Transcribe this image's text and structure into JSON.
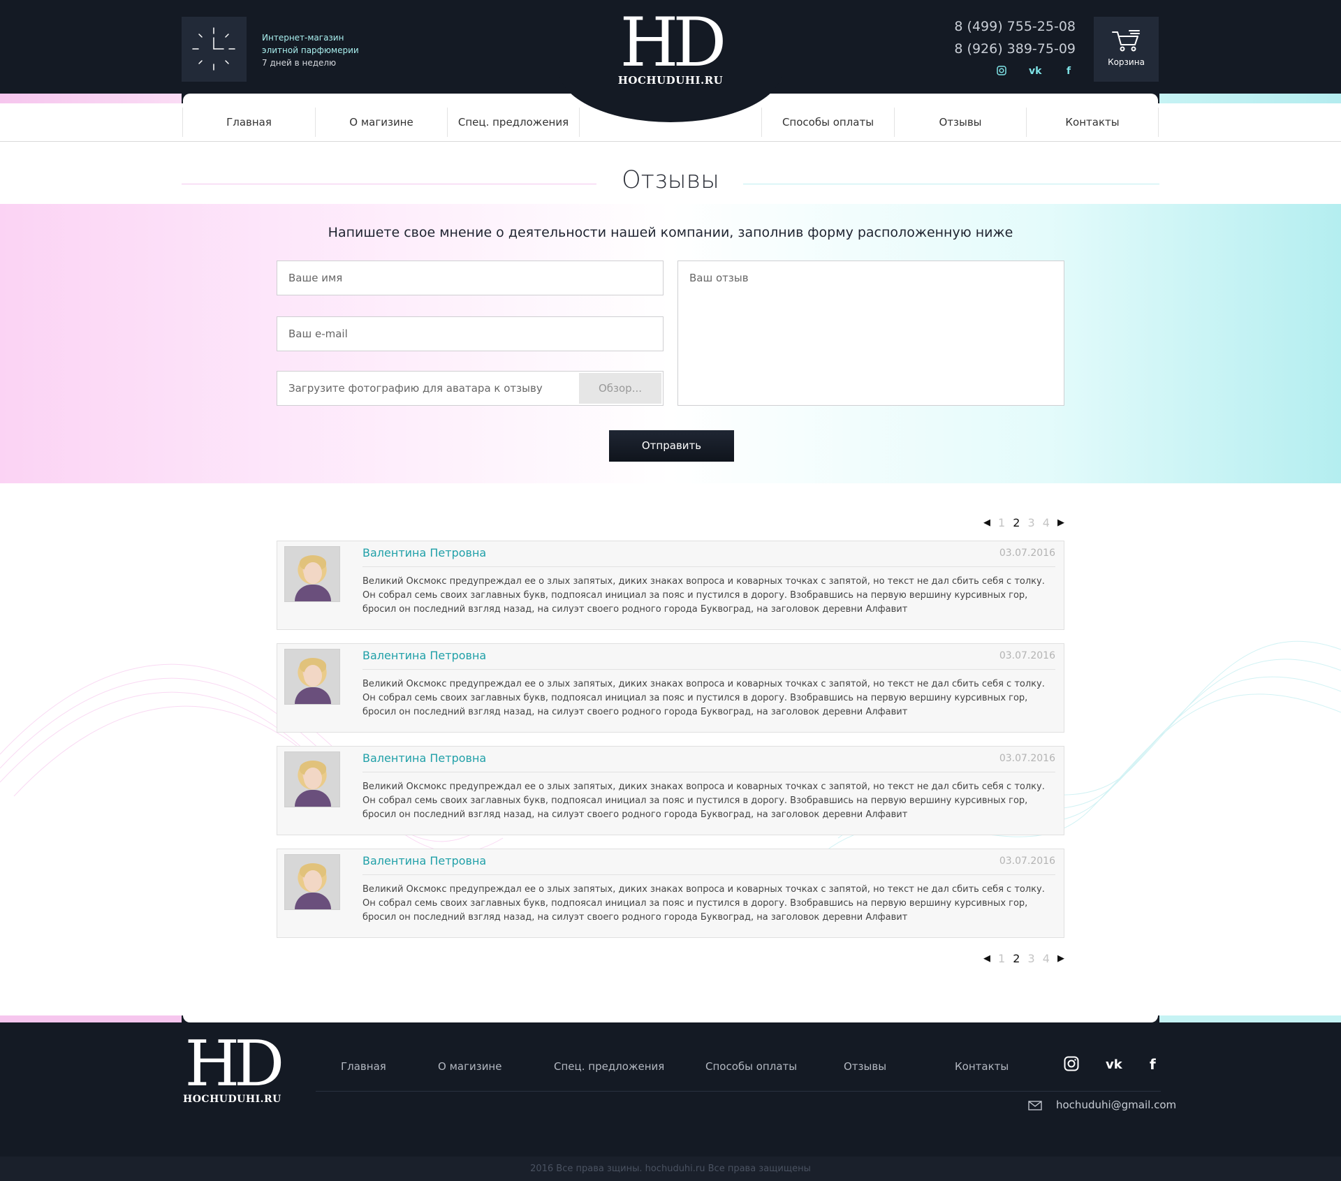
{
  "header": {
    "tagline": [
      "Интернет-магазин",
      "элитной парфюмерии",
      "7 дней в неделю"
    ],
    "logo_mark": "HD",
    "logo_text": "HOCHUDUHI.RU",
    "phones": [
      "8 (499) 755-25-08",
      "8 (926) 389-75-09"
    ],
    "socials": [
      {
        "icon": "instagram-icon",
        "glyph": "◘"
      },
      {
        "icon": "vk-icon",
        "glyph": "vk"
      },
      {
        "icon": "facebook-icon",
        "glyph": "f"
      }
    ],
    "cart_label": "Корзина",
    "colors": {
      "bg": "#141a24",
      "accent": "#a9efee"
    }
  },
  "nav": {
    "items": [
      "Главная",
      "О магизине",
      "Спец. предложения",
      "Способы оплаты",
      "Отзывы",
      "Контакты"
    ]
  },
  "page": {
    "title": "Отзывы"
  },
  "form": {
    "intro": "Напишете свое мнение о деятельности нашей компании, заполнив форму расположенную ниже",
    "name_placeholder": "Ваше имя",
    "email_placeholder": "Ваш e-mail",
    "photo_placeholder": "Загрузите фотографию для аватара  к отзыву",
    "browse_label": "Обзор...",
    "review_placeholder": "Ваш отзыв",
    "submit_label": "Отправить"
  },
  "pagination": {
    "pages": [
      "1",
      "2",
      "3",
      "4"
    ],
    "active": "2"
  },
  "reviews": [
    {
      "name": "Валентина Петровна",
      "date": "03.07.2016",
      "text": "Великий Оксмокс предупреждал ее о злых запятых, диких знаках вопроса и коварных точках с запятой, но текст не дал сбить себя с толку. Он собрал семь своих заглавных букв, подпоясал инициал за пояс и пустился в дорогу. Взобравшись на первую вершину курсивных гор, бросил он последний взгляд назад, на силуэт своего родного города Буквоград, на заголовок деревни Алфавит"
    },
    {
      "name": "Валентина Петровна",
      "date": "03.07.2016",
      "text": "Великий Оксмокс предупреждал ее о злых запятых, диких знаках вопроса и коварных точках с запятой, но текст не дал сбить себя с толку. Он собрал семь своих заглавных букв, подпоясал инициал за пояс и пустился в дорогу. Взобравшись на первую вершину курсивных гор, бросил он последний взгляд назад, на силуэт своего родного города Буквоград, на заголовок деревни Алфавит"
    },
    {
      "name": "Валентина Петровна",
      "date": "03.07.2016",
      "text": "Великий Оксмокс предупреждал ее о злых запятых, диких знаках вопроса и коварных точках с запятой, но текст не дал сбить себя с толку. Он собрал семь своих заглавных букв, подпоясал инициал за пояс и пустился в дорогу. Взобравшись на первую вершину курсивных гор, бросил он последний взгляд назад, на силуэт своего родного города Буквоград, на заголовок деревни Алфавит"
    },
    {
      "name": "Валентина Петровна",
      "date": "03.07.2016",
      "text": "Великий Оксмокс предупреждал ее о злых запятых, диких знаках вопроса и коварных точках с запятой, но текст не дал сбить себя с толку. Он собрал семь своих заглавных букв, подпоясал инициал за пояс и пустился в дорогу. Взобравшись на первую вершину курсивных гор, бросил он последний взгляд назад, на силуэт своего родного города Буквоград, на заголовок деревни Алфавит"
    }
  ],
  "footer": {
    "logo_mark": "HD",
    "logo_text": "HOCHUDUHI.RU",
    "links": [
      "Главная",
      "О магизине",
      "Спец. предложения",
      "Способы оплаты",
      "Отзывы",
      "Контакты"
    ],
    "socials": [
      {
        "icon": "instagram-icon",
        "glyph": "◘"
      },
      {
        "icon": "vk-icon",
        "glyph": "vk"
      },
      {
        "icon": "facebook-icon",
        "glyph": "f"
      }
    ],
    "email": "hochuduhi@gmail.com",
    "copyright": "2016 Все права зщины. hochuduhi.ru Все права защищены"
  }
}
